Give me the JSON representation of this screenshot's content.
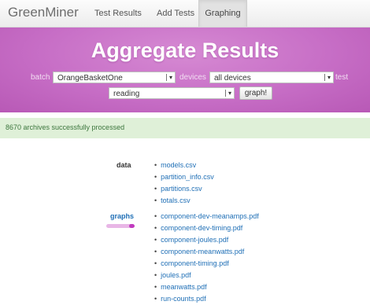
{
  "navbar": {
    "brand": "GreenMiner",
    "items": [
      "Test Results",
      "Add Tests",
      "Graphing"
    ],
    "active": "Graphing"
  },
  "hero": {
    "title": "Aggregate Results",
    "batch_label": "batch",
    "batch_value": "OrangeBasketOne",
    "devices_label": "devices",
    "devices_value": "all devices",
    "test_label": "test",
    "metric_value": "reading",
    "graph_button": "graph!"
  },
  "alert": {
    "text": "8670 archives successfully processed"
  },
  "data_section": {
    "label": "data",
    "files": [
      "models.csv",
      "partition_info.csv",
      "partitions.csv",
      "totals.csv"
    ]
  },
  "graphs_section": {
    "label": "graphs",
    "progress": 0.2,
    "files": [
      "component-dev-meanamps.pdf",
      "component-dev-timing.pdf",
      "component-joules.pdf",
      "component-meanwatts.pdf",
      "component-timing.pdf",
      "joules.pdf",
      "meanwatts.pdf",
      "run-counts.pdf"
    ]
  },
  "colors": {
    "hero": "#c76ec6",
    "link": "#1f6fb6",
    "graphs_label": "#1f6fb6",
    "alert_bg": "#dff0d8"
  },
  "icons": {
    "select_arrow": "chevron-down-icon"
  }
}
